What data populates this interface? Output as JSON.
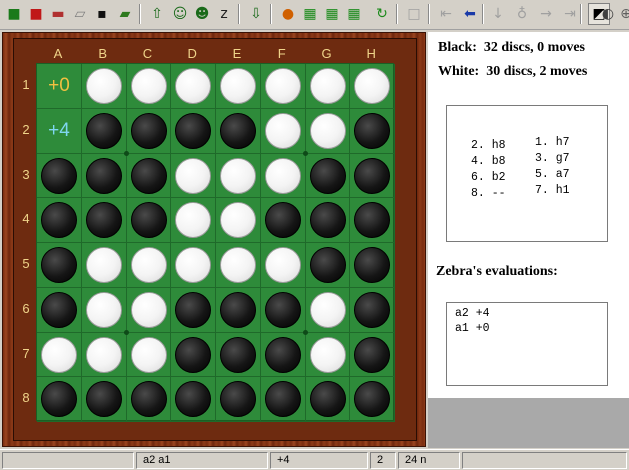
{
  "toolbar": {
    "buttons": [
      {
        "name": "stop-game-icon",
        "glyph": "■",
        "color": "#1a7a1a"
      },
      {
        "name": "new-game-icon",
        "glyph": "■",
        "color": "#c01818"
      },
      {
        "name": "load-book-icon",
        "glyph": "▬",
        "color": "#b03030"
      },
      {
        "name": "page-icon",
        "glyph": "▱",
        "color": "#808080"
      },
      {
        "name": "save-game-icon",
        "glyph": "▪",
        "color": "#101010"
      },
      {
        "name": "open-folder-icon",
        "glyph": "▰",
        "color": "#2e7a1e"
      },
      {
        "name": "hint-arrow-icon",
        "glyph": "⇧",
        "color": "#1a6a1a"
      },
      {
        "name": "person-search-icon",
        "glyph": "☺",
        "color": "#1a6a1a"
      },
      {
        "name": "person-analyze-icon",
        "glyph": "☻",
        "color": "#1a6a1a"
      },
      {
        "name": "sleep-zz-icon",
        "glyph": "z",
        "color": "#202020"
      },
      {
        "name": "drop-arrow-icon",
        "glyph": "⇩",
        "color": "#1a6a1a"
      },
      {
        "name": "rules-icon",
        "glyph": "●",
        "color": "#d06000"
      },
      {
        "name": "board-icon-1",
        "glyph": "▦",
        "color": "#1a8a1a"
      },
      {
        "name": "board-icon-2",
        "glyph": "▦",
        "color": "#1a8a1a"
      },
      {
        "name": "board-icon-3",
        "glyph": "▦",
        "color": "#1a8a1a"
      },
      {
        "name": "refresh-icon",
        "glyph": "↻",
        "color": "#1a8a1a"
      },
      {
        "name": "blank-page-icon",
        "glyph": "□",
        "color": "#a0a0a0"
      },
      {
        "name": "first-move-icon",
        "glyph": "⇤",
        "color": "#a0a0a0"
      },
      {
        "name": "back-icon",
        "glyph": "⬅",
        "color": "#1a3aa8"
      },
      {
        "name": "down-icon",
        "glyph": "↓",
        "color": "#a0a0a0"
      },
      {
        "name": "lightbulb-icon",
        "glyph": "♁",
        "color": "#a0a0a0"
      },
      {
        "name": "forward-icon",
        "glyph": "→",
        "color": "#a0a0a0"
      },
      {
        "name": "last-move-icon",
        "glyph": "⇥",
        "color": "#a0a0a0"
      },
      {
        "name": "flip-board-icon",
        "glyph": "◩",
        "color": "#000000"
      },
      {
        "name": "contrast-icon",
        "glyph": "◐",
        "color": "#404040"
      },
      {
        "name": "globe-icon",
        "glyph": "⊕",
        "color": "#606060"
      }
    ]
  },
  "board": {
    "columns": [
      "A",
      "B",
      "C",
      "D",
      "E",
      "F",
      "G",
      "H"
    ],
    "rows": [
      "1",
      "2",
      "3",
      "4",
      "5",
      "6",
      "7",
      "8"
    ],
    "cells": [
      [
        "empty",
        "white",
        "white",
        "white",
        "white",
        "white",
        "white",
        "white"
      ],
      [
        "empty",
        "black",
        "black",
        "black",
        "black",
        "white",
        "white",
        "black"
      ],
      [
        "black",
        "black",
        "black",
        "white",
        "white",
        "white",
        "black",
        "black"
      ],
      [
        "black",
        "black",
        "black",
        "white",
        "white",
        "black",
        "black",
        "black"
      ],
      [
        "black",
        "white",
        "white",
        "white",
        "white",
        "white",
        "black",
        "black"
      ],
      [
        "black",
        "white",
        "white",
        "black",
        "black",
        "black",
        "white",
        "black"
      ],
      [
        "white",
        "white",
        "white",
        "black",
        "black",
        "black",
        "white",
        "black"
      ],
      [
        "black",
        "black",
        "black",
        "black",
        "black",
        "black",
        "black",
        "black"
      ]
    ],
    "evaluations": [
      {
        "square": "a1",
        "text": "+0",
        "color": "#f0c040"
      },
      {
        "square": "a2",
        "text": "+4",
        "color": "#7fd6f0"
      }
    ]
  },
  "score": {
    "black_label": "Black:",
    "black_value": "32 discs, 0 moves",
    "white_label": "White:",
    "white_value": "30 discs, 2 moves"
  },
  "moves": {
    "row1": {
      "a": "",
      "b": "1. h7"
    },
    "row2": {
      "a": "2. h8",
      "b": "3. g7"
    },
    "row3": {
      "a": "4. b8",
      "b": "5. a7"
    },
    "row4": {
      "a": "6. b2",
      "b": "7. h1"
    },
    "row5": {
      "a": "8. --",
      "b": ""
    }
  },
  "evaluations_panel": {
    "heading": "Zebra's evaluations:",
    "lines": [
      "a2 +4",
      "a1 +0"
    ]
  },
  "statusbar": {
    "cell1": "",
    "cell2": "a2 a1",
    "cell3": "+4",
    "cell4": "2",
    "cell5": "24 n",
    "cell6": ""
  },
  "colors": {
    "board_green": "#2e8b3a",
    "wood": "#7a2d10",
    "label_gold": "#f0d48a"
  }
}
